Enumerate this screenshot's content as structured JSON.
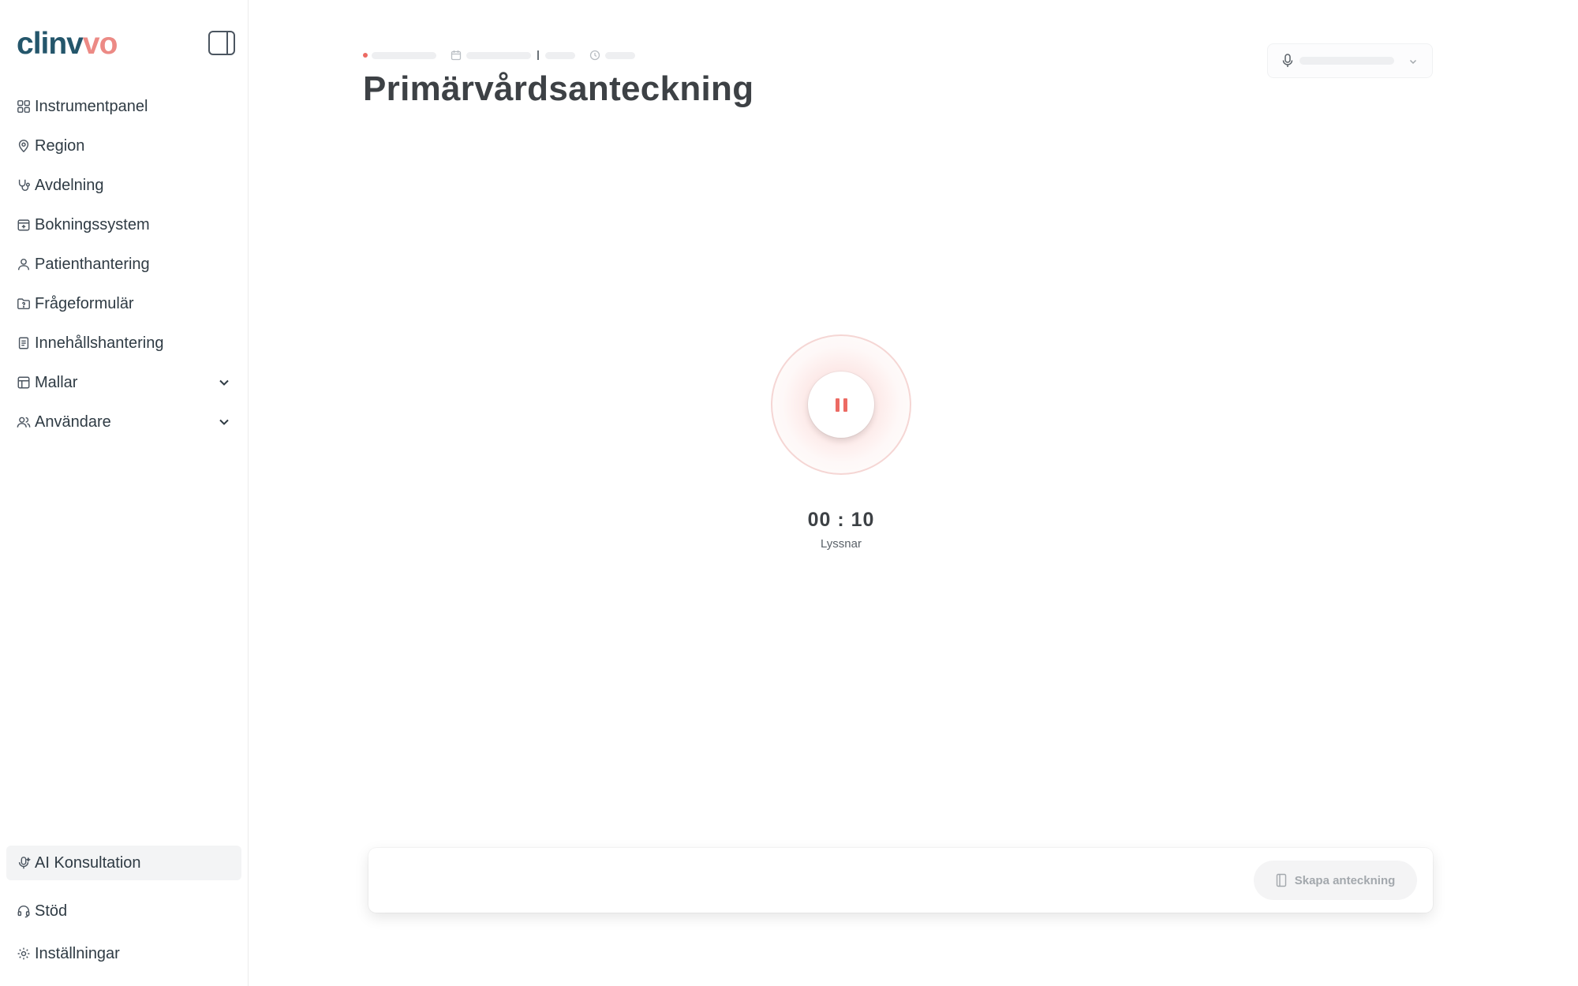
{
  "brand": {
    "logo_part1": "clinv",
    "logo_part2": "vo"
  },
  "sidebar": {
    "items": [
      {
        "label": "Instrumentpanel",
        "icon": "dashboard-icon"
      },
      {
        "label": "Region",
        "icon": "map-pin-icon"
      },
      {
        "label": "Avdelning",
        "icon": "stethoscope-icon"
      },
      {
        "label": "Bokningssystem",
        "icon": "calendar-plus-icon"
      },
      {
        "label": "Patienthantering",
        "icon": "user-icon"
      },
      {
        "label": "Frågeformulär",
        "icon": "folder-question-icon"
      },
      {
        "label": "Innehållshantering",
        "icon": "document-icon"
      },
      {
        "label": "Mallar",
        "icon": "table-icon",
        "expandable": true
      },
      {
        "label": "Användare",
        "icon": "users-icon",
        "expandable": true
      }
    ],
    "bottom_items": [
      {
        "label": "AI Konsultation",
        "icon": "ai-mic-icon",
        "active": true
      },
      {
        "label": "Stöd",
        "icon": "headset-icon"
      },
      {
        "label": "Inställningar",
        "icon": "gear-icon"
      }
    ]
  },
  "main": {
    "title": "Primärvårdsanteckning",
    "recorder": {
      "timer": "00 : 10",
      "status": "Lyssnar",
      "accent": "#ec6a63"
    },
    "create_note_label": "Skapa anteckning"
  }
}
